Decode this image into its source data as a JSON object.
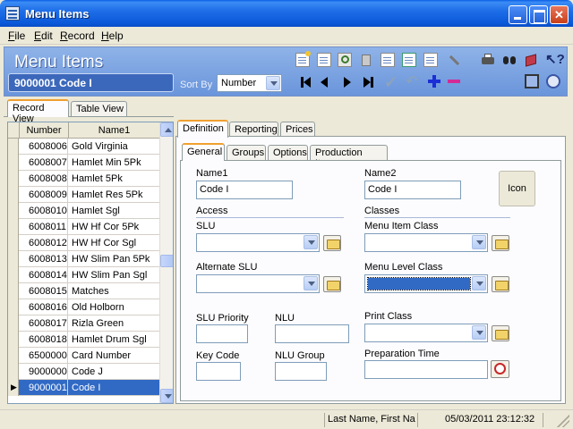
{
  "window": {
    "title": "Menu Items"
  },
  "menubar": {
    "items": [
      "File",
      "Edit",
      "Record",
      "Help"
    ]
  },
  "header": {
    "title": "Menu Items",
    "record_display": "9000001  Code I",
    "sort_by_label": "Sort By",
    "sort_by_value": "Number"
  },
  "toolbar_icons": [
    "new-icon",
    "copy-icon",
    "lookup-icon",
    "delete-icon",
    "notes-icon",
    "paste-icon",
    "clone-icon",
    "wand-icon",
    "print-icon",
    "find-icon",
    "book-icon",
    "help-pointer-icon",
    "first-icon",
    "prev-icon",
    "next-icon",
    "last-icon",
    "save-check-icon",
    "undo-icon",
    "add-icon",
    "remove-icon",
    "monitor-icon",
    "sync-icon"
  ],
  "left_tabs": [
    "Record View",
    "Table View"
  ],
  "grid": {
    "columns": [
      "Number",
      "Name1"
    ],
    "rows": [
      {
        "number": "6008006",
        "name": "Gold Virginia"
      },
      {
        "number": "6008007",
        "name": "Hamlet Min 5Pk"
      },
      {
        "number": "6008008",
        "name": "Hamlet 5Pk"
      },
      {
        "number": "6008009",
        "name": "Hamlet Res 5Pk"
      },
      {
        "number": "6008010",
        "name": "Hamlet Sgl"
      },
      {
        "number": "6008011",
        "name": "HW Hf Cor 5Pk"
      },
      {
        "number": "6008012",
        "name": "HW Hf Cor Sgl"
      },
      {
        "number": "6008013",
        "name": "HW Slim Pan 5Pk"
      },
      {
        "number": "6008014",
        "name": "HW Slim Pan Sgl"
      },
      {
        "number": "6008015",
        "name": "Matches"
      },
      {
        "number": "6008016",
        "name": "Old Holborn"
      },
      {
        "number": "6008017",
        "name": "Rizla Green"
      },
      {
        "number": "6008018",
        "name": "Hamlet Drum Sgl"
      },
      {
        "number": "6500000",
        "name": "Card Number"
      },
      {
        "number": "9000000",
        "name": "Code J"
      },
      {
        "number": "9000001",
        "name": "Code I"
      }
    ]
  },
  "main_tabs": [
    "Definition",
    "Reporting",
    "Prices"
  ],
  "sub_tabs": [
    "General",
    "Groups",
    "Options",
    "Production Items"
  ],
  "form": {
    "name1_label": "Name1",
    "name1_value": "Code I",
    "name2_label": "Name2",
    "name2_value": "Code I",
    "icon_button": "Icon",
    "access_heading": "Access",
    "classes_heading": "Classes",
    "slu_label": "SLU",
    "menu_item_class_label": "Menu Item Class",
    "alternate_slu_label": "Alternate SLU",
    "menu_level_class_label": "Menu Level Class",
    "slu_priority_label": "SLU Priority",
    "nlu_label": "NLU",
    "print_class_label": "Print Class",
    "key_code_label": "Key Code",
    "nlu_group_label": "NLU Group",
    "preparation_time_label": "Preparation Time"
  },
  "status": {
    "user": "Last Name, First Na",
    "datetime": "05/03/2011 23:12:32"
  },
  "colors": {
    "title_bar": "#0a58d8",
    "header_band": "#7aa0e0",
    "selection": "#316ac5",
    "tab_highlight": "#f0a030"
  }
}
